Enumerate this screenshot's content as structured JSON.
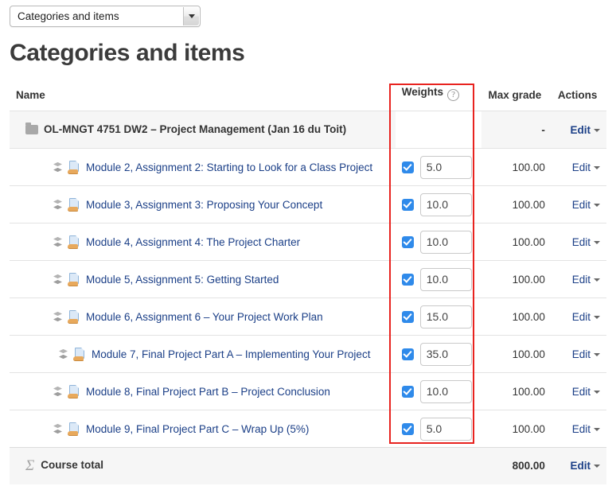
{
  "select": {
    "name": "grade-view-select",
    "value": "Categories and items",
    "caret_icon": "chevron-down-icon"
  },
  "page_title": "Categories and items",
  "table": {
    "headers": {
      "name": "Name",
      "weights": "Weights",
      "weights_help_icon": "?",
      "max_grade": "Max grade",
      "actions": "Actions"
    },
    "category": {
      "label": "OL-MNGT 4751 DW2 – Project Management (Jan 16 du Toit)",
      "icon": "folder-icon",
      "weight": "",
      "max_grade": "-",
      "action": "Edit"
    },
    "rows": [
      {
        "label": "Module 2, Assignment 2: Starting to Look for a Class Project",
        "weight": "5.0",
        "weight_checked": true,
        "max_grade": "100.00",
        "action": "Edit"
      },
      {
        "label": "Module 3, Assignment 3: Proposing Your Concept",
        "weight": "10.0",
        "weight_checked": true,
        "max_grade": "100.00",
        "action": "Edit"
      },
      {
        "label": "Module 4, Assignment 4: The Project Charter",
        "weight": "10.0",
        "weight_checked": true,
        "max_grade": "100.00",
        "action": "Edit"
      },
      {
        "label": "Module 5, Assignment 5: Getting Started",
        "weight": "10.0",
        "weight_checked": true,
        "max_grade": "100.00",
        "action": "Edit"
      },
      {
        "label": "Module 6, Assignment 6 – Your Project Work Plan",
        "weight": "15.0",
        "weight_checked": true,
        "max_grade": "100.00",
        "action": "Edit"
      },
      {
        "label": "Module 7, Final Project Part A – Implementing Your Project",
        "weight": "35.0",
        "weight_checked": true,
        "max_grade": "100.00",
        "action": "Edit"
      },
      {
        "label": "Module 8, Final Project Part B – Project Conclusion",
        "weight": "10.0",
        "weight_checked": true,
        "max_grade": "100.00",
        "action": "Edit"
      },
      {
        "label": "Module 9, Final Project Part C – Wrap Up (5%)",
        "weight": "5.0",
        "weight_checked": true,
        "max_grade": "100.00",
        "action": "Edit"
      }
    ],
    "total": {
      "label": "Course total",
      "icon": "sigma-icon",
      "sigma_glyph": "Σ",
      "max_grade": "800.00",
      "action": "Edit"
    }
  },
  "annotation": {
    "type": "rectangle-highlight",
    "color": "#e8231f",
    "target": "weights-column"
  }
}
